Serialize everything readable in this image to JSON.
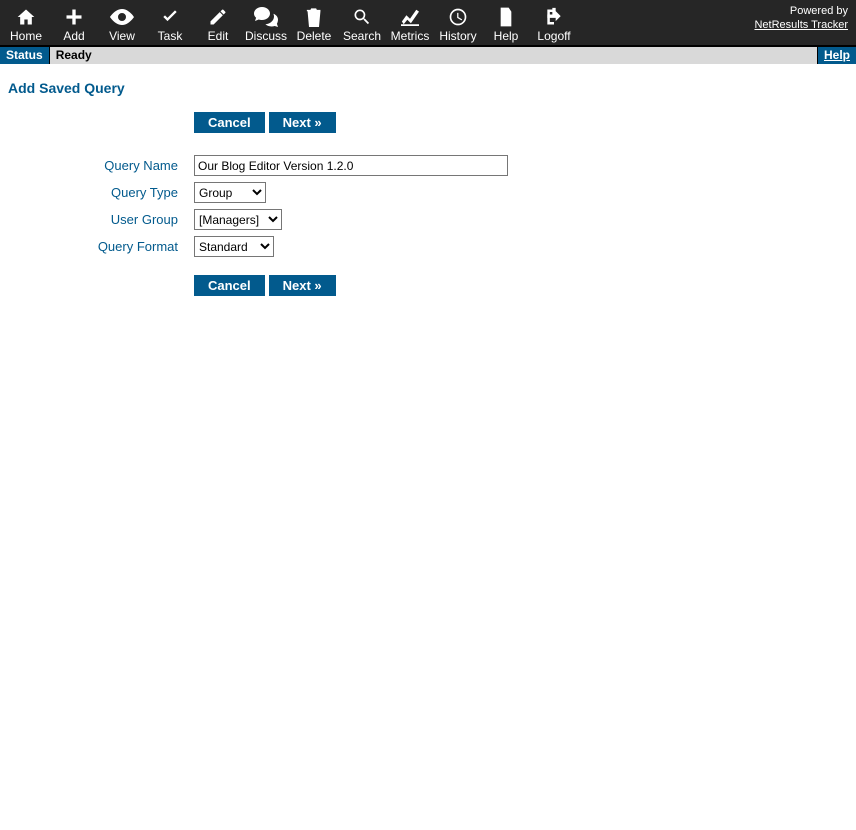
{
  "toolbar": {
    "items": [
      {
        "label": "Home",
        "icon": "home-icon"
      },
      {
        "label": "Add",
        "icon": "plus-icon"
      },
      {
        "label": "View",
        "icon": "eye-icon"
      },
      {
        "label": "Task",
        "icon": "check-icon"
      },
      {
        "label": "Edit",
        "icon": "pencil-icon"
      },
      {
        "label": "Discuss",
        "icon": "comments-icon"
      },
      {
        "label": "Delete",
        "icon": "trash-icon"
      },
      {
        "label": "Search",
        "icon": "search-icon"
      },
      {
        "label": "Metrics",
        "icon": "chart-icon"
      },
      {
        "label": "History",
        "icon": "clock-icon"
      },
      {
        "label": "Help",
        "icon": "file-icon"
      },
      {
        "label": "Logoff",
        "icon": "logoff-icon"
      }
    ],
    "powered_by": "Powered by",
    "brand_link": "NetResults Tracker"
  },
  "statusbar": {
    "status_label": "Status",
    "status_value": "Ready",
    "help_label": "Help"
  },
  "page": {
    "title": "Add Saved Query"
  },
  "buttons": {
    "cancel": "Cancel",
    "next": "Next »"
  },
  "form": {
    "query_name": {
      "label": "Query Name",
      "value": "Our Blog Editor Version 1.2.0"
    },
    "query_type": {
      "label": "Query Type",
      "selected": "Group"
    },
    "user_group": {
      "label": "User Group",
      "selected": "[Managers]"
    },
    "query_format": {
      "label": "Query Format",
      "selected": "Standard"
    }
  }
}
